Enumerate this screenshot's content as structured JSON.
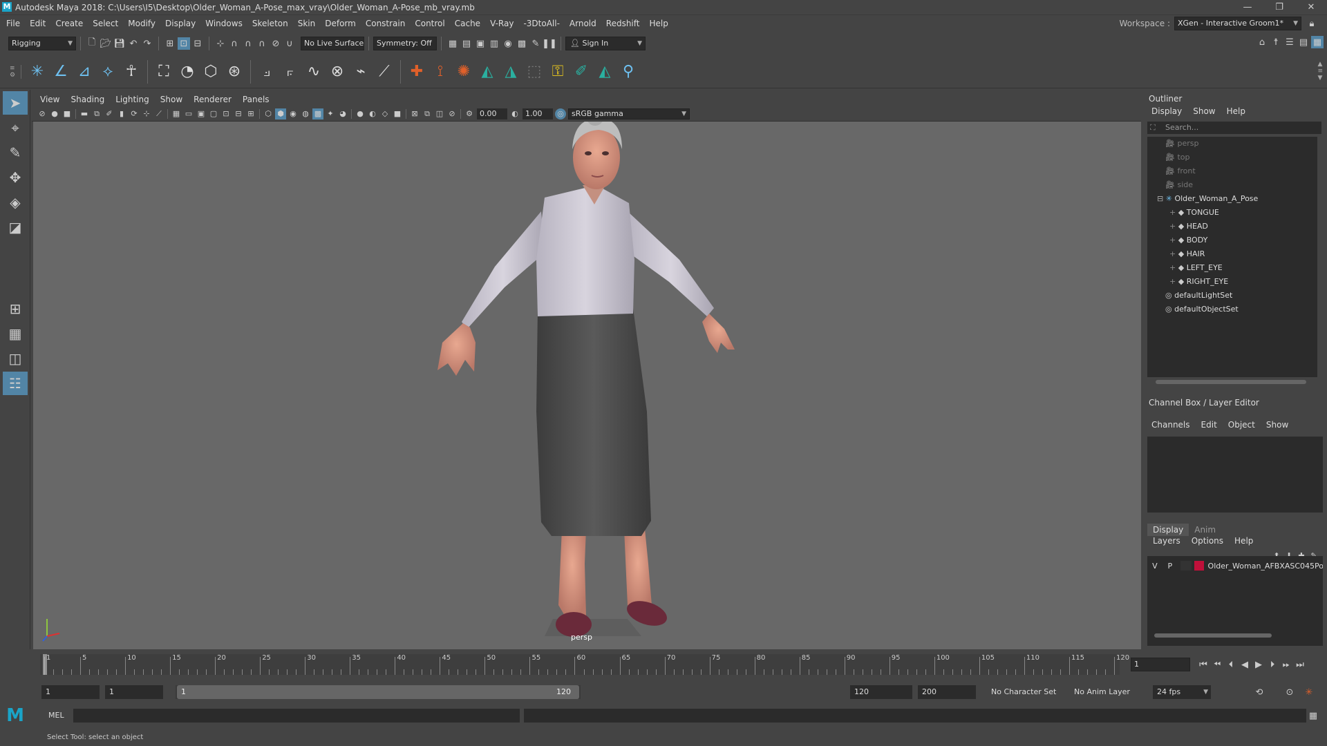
{
  "window": {
    "title": "Autodesk Maya 2018: C:\\Users\\I5\\Desktop\\Older_Woman_A-Pose_max_vray\\Older_Woman_A-Pose_mb_vray.mb",
    "logo": "M",
    "minimize_glyph": "—",
    "restore_glyph": "❐",
    "close_glyph": "✕"
  },
  "menubar": {
    "items": [
      "File",
      "Edit",
      "Create",
      "Select",
      "Modify",
      "Display",
      "Windows",
      "Skeleton",
      "Skin",
      "Deform",
      "Constrain",
      "Control",
      "Cache",
      "V-Ray",
      "-3DtoAll-",
      "Arnold",
      "Redshift",
      "Help"
    ],
    "workspace_label": "Workspace :",
    "workspace_value": "XGen - Interactive Groom1*"
  },
  "statusline": {
    "mode": "Rigging",
    "live_surface": "No Live Surface",
    "symmetry": "Symmetry: Off",
    "sign_in": "Sign In"
  },
  "viewport": {
    "menu": [
      "View",
      "Shading",
      "Lighting",
      "Show",
      "Renderer",
      "Panels"
    ],
    "exposure": "0.00",
    "gamma": "1.00",
    "color_space": "sRGB gamma",
    "camera_label": "persp"
  },
  "outliner": {
    "title": "Outliner",
    "menu": [
      "Display",
      "Show",
      "Help"
    ],
    "search_placeholder": "Search...",
    "items": [
      {
        "label": "persp",
        "level": 1,
        "kind": "camera",
        "dim": true
      },
      {
        "label": "top",
        "level": 1,
        "kind": "camera",
        "dim": true
      },
      {
        "label": "front",
        "level": 1,
        "kind": "camera",
        "dim": true
      },
      {
        "label": "side",
        "level": 1,
        "kind": "camera",
        "dim": true
      },
      {
        "label": "Older_Woman_A_Pose",
        "level": 0,
        "kind": "group",
        "dim": false
      },
      {
        "label": "TONGUE",
        "level": 2,
        "kind": "mesh",
        "dim": false
      },
      {
        "label": "HEAD",
        "level": 2,
        "kind": "mesh",
        "dim": false
      },
      {
        "label": "BODY",
        "level": 2,
        "kind": "mesh",
        "dim": false
      },
      {
        "label": "HAIR",
        "level": 2,
        "kind": "mesh",
        "dim": false
      },
      {
        "label": "LEFT_EYE",
        "level": 2,
        "kind": "mesh",
        "dim": false
      },
      {
        "label": "RIGHT_EYE",
        "level": 2,
        "kind": "mesh",
        "dim": false
      },
      {
        "label": "defaultLightSet",
        "level": 1,
        "kind": "set",
        "dim": false
      },
      {
        "label": "defaultObjectSet",
        "level": 1,
        "kind": "set",
        "dim": false
      }
    ]
  },
  "channelbox": {
    "title": "Channel Box / Layer Editor",
    "menu": [
      "Channels",
      "Edit",
      "Object",
      "Show"
    ],
    "tabs": [
      "Display",
      "Anim"
    ],
    "layer_menu": [
      "Layers",
      "Options",
      "Help"
    ],
    "layer": {
      "v": "V",
      "p": "P",
      "name": "Older_Woman_AFBXASC045Po",
      "color": "#c0103a"
    }
  },
  "timeline": {
    "ticks": [
      1,
      5,
      10,
      15,
      20,
      25,
      30,
      35,
      40,
      45,
      50,
      55,
      60,
      65,
      70,
      75,
      80,
      85,
      90,
      95,
      100,
      105,
      110,
      115,
      120
    ],
    "current_frame": "1"
  },
  "range": {
    "start": "1",
    "playback_start": "1",
    "slider_start": "1",
    "slider_end": "120",
    "playback_end": "120",
    "end": "200",
    "character_set": "No Character Set",
    "anim_layer": "No Anim Layer",
    "fps": "24 fps"
  },
  "command": {
    "label": "MEL"
  },
  "helpline": {
    "text": "Select Tool: select an object"
  },
  "colors": {
    "accent": "#5285a6",
    "maya_blue": "#1aa4c8",
    "layer_red": "#c0103a"
  }
}
